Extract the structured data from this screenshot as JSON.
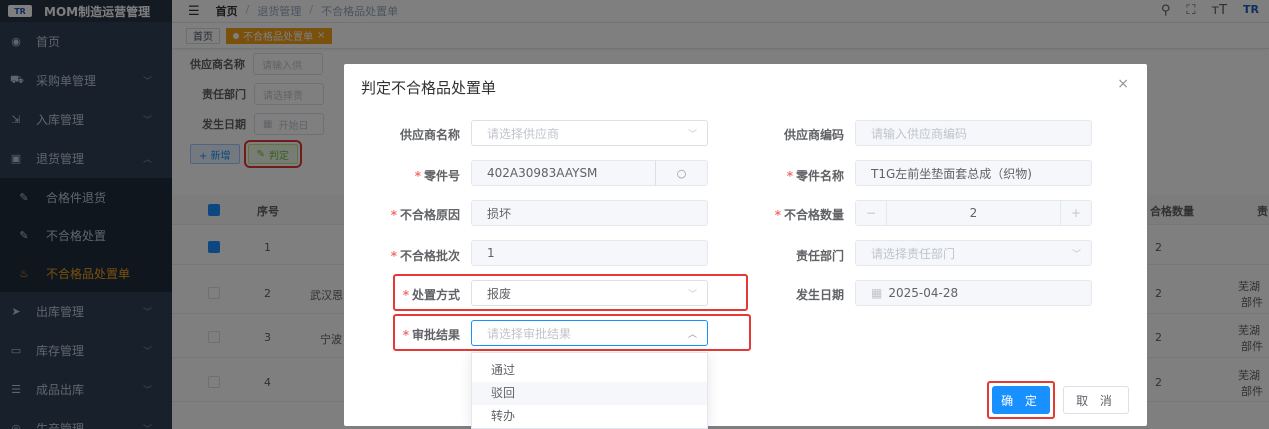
{
  "app": {
    "title": "MOM制造运营管理",
    "logo_text": "TR"
  },
  "sidebar": {
    "items": [
      {
        "label": "首页",
        "icon": "dashboard-icon"
      },
      {
        "label": "采购单管理",
        "icon": "cart-icon"
      },
      {
        "label": "入库管理",
        "icon": "inbound-icon"
      },
      {
        "label": "退货管理",
        "icon": "return-icon"
      }
    ],
    "sub_items": [
      {
        "label": "合格件退货"
      },
      {
        "label": "不合格处置"
      },
      {
        "label": "不合格品处置单"
      }
    ],
    "items_after": [
      {
        "label": "出库管理"
      },
      {
        "label": "库存管理"
      },
      {
        "label": "成品出库"
      },
      {
        "label": "生产管理"
      }
    ]
  },
  "navbar": {
    "breadcrumb": [
      "首页",
      "退货管理",
      "不合格品处置单"
    ],
    "sep": "/"
  },
  "tags": {
    "home": "首页",
    "current": "不合格品处置单",
    "close": "×"
  },
  "search": {
    "supplier_label": "供应商名称",
    "supplier_ph": "请输入供",
    "dept_label": "责任部门",
    "dept_ph": "请选择责",
    "date_label": "发生日期",
    "date_ph": "开始日"
  },
  "toolbar": {
    "add": "+ 新增",
    "judge": "判定"
  },
  "table": {
    "col_seq": "序号",
    "col_qty": "合格数量",
    "col_last": "责",
    "rows": [
      {
        "seq": "1",
        "mid": "",
        "qty": "2",
        "right": ""
      },
      {
        "seq": "2",
        "mid": "武汉恩",
        "qty": "2",
        "right": "芜湖"
      },
      {
        "seq": "3",
        "mid": "宁波",
        "qty": "2",
        "right": "芜湖"
      },
      {
        "seq": "4",
        "mid": "",
        "qty": "2",
        "right": "芜湖"
      }
    ],
    "right_sub": "部件"
  },
  "dialog": {
    "title": "判定不合格品处置单",
    "close": "×",
    "fields": {
      "supplier_name": {
        "label": "供应商名称",
        "placeholder": "请选择供应商"
      },
      "supplier_code": {
        "label": "供应商编码",
        "placeholder": "请输入供应商编码"
      },
      "part_no": {
        "label": "零件号",
        "value": "402A30983AAYSM"
      },
      "part_name": {
        "label": "零件名称",
        "value": "T1G左前坐垫面套总成（织物)"
      },
      "reason": {
        "label": "不合格原因",
        "value": "损坏"
      },
      "qty": {
        "label": "不合格数量",
        "value": "2",
        "minus": "−",
        "plus": "+"
      },
      "batch": {
        "label": "不合格批次",
        "value": "1"
      },
      "dept": {
        "label": "责任部门",
        "placeholder": "请选择责任部门"
      },
      "method": {
        "label": "处置方式",
        "value": "报废"
      },
      "date": {
        "label": "发生日期",
        "value": "2025-04-28"
      },
      "approval": {
        "label": "审批结果",
        "placeholder": "请选择审批结果"
      }
    },
    "approval_options": [
      "通过",
      "驳回",
      "转办"
    ],
    "ok": "确 定",
    "cancel": "取 消"
  },
  "colors": {
    "primary": "#1890ff",
    "sidebar": "#304156",
    "accent": "#f4a11a",
    "highlight": "#e53935"
  }
}
